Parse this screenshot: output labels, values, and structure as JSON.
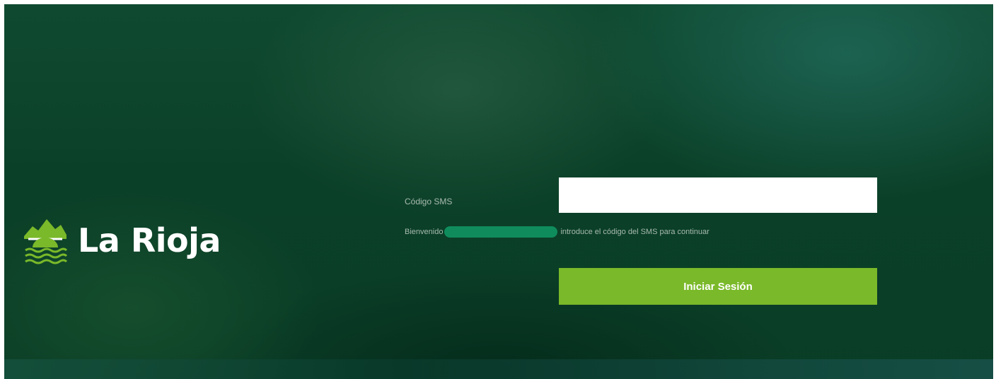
{
  "brand": {
    "name": "La Rioja",
    "logo_icon": "la-rioja-logo-icon",
    "accent_color": "#7ab929"
  },
  "form": {
    "sms_label": "Código SMS",
    "sms_value": "",
    "welcome_prefix": "Bienvenido",
    "welcome_suffix": "introduce el código del SMS para continuar",
    "submit_label": "Iniciar Sesión"
  }
}
